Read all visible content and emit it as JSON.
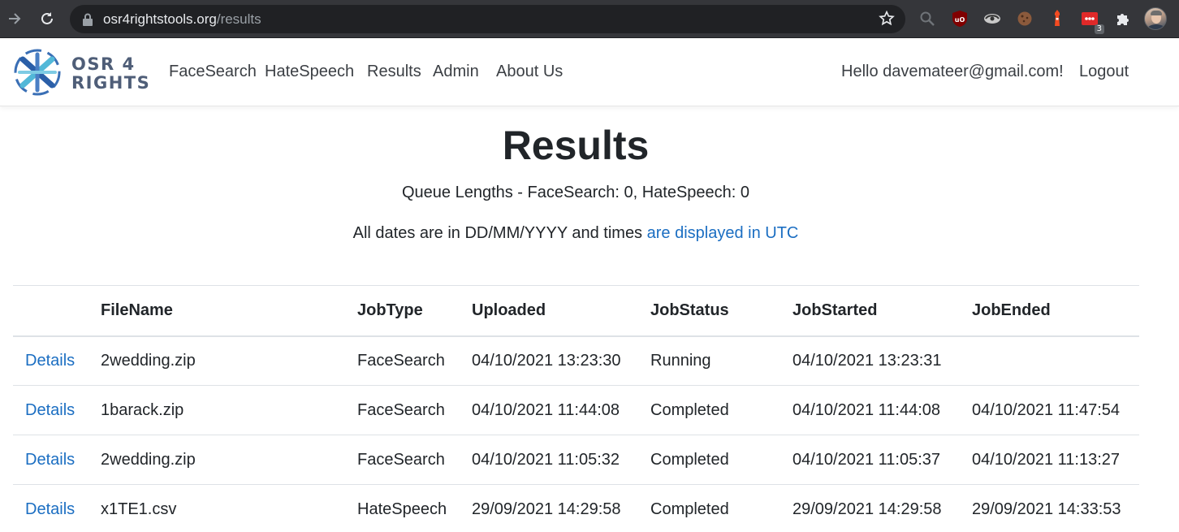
{
  "browser": {
    "url_host": "osr4rightstools.org",
    "url_path": "/results",
    "extension_badge": "3"
  },
  "brand": {
    "line1": "OSR 4",
    "line2": "RIGHTS"
  },
  "nav": {
    "items": [
      {
        "label": "FaceSearch"
      },
      {
        "label": "HateSpeech"
      },
      {
        "label": "Results"
      },
      {
        "label": "Admin"
      },
      {
        "label": "About Us"
      }
    ],
    "greeting": "Hello davemateer@gmail.com!",
    "logout": "Logout"
  },
  "page": {
    "title": "Results",
    "queue": "Queue Lengths - FaceSearch: 0, HateSpeech: 0",
    "dates_prefix": "All dates are in DD/MM/YYYY and times ",
    "dates_link": "are displayed in UTC"
  },
  "table": {
    "headers": [
      "",
      "FileName",
      "JobType",
      "Uploaded",
      "JobStatus",
      "JobStarted",
      "JobEnded"
    ],
    "rows": [
      {
        "link": "Details",
        "file": "2wedding.zip",
        "type": "FaceSearch",
        "uploaded": "04/10/2021 13:23:30",
        "status": "Running",
        "started": "04/10/2021 13:23:31",
        "ended": ""
      },
      {
        "link": "Details",
        "file": "1barack.zip",
        "type": "FaceSearch",
        "uploaded": "04/10/2021 11:44:08",
        "status": "Completed",
        "started": "04/10/2021 11:44:08",
        "ended": "04/10/2021 11:47:54"
      },
      {
        "link": "Details",
        "file": "2wedding.zip",
        "type": "FaceSearch",
        "uploaded": "04/10/2021 11:05:32",
        "status": "Completed",
        "started": "04/10/2021 11:05:37",
        "ended": "04/10/2021 11:13:27"
      },
      {
        "link": "Details",
        "file": "x1TE1.csv",
        "type": "HateSpeech",
        "uploaded": "29/09/2021 14:29:58",
        "status": "Completed",
        "started": "29/09/2021 14:29:58",
        "ended": "29/09/2021 14:33:53"
      }
    ]
  },
  "colors": {
    "link": "#1b6ec2",
    "brand": "#4f5e78",
    "chrome_bg": "#35363a"
  }
}
